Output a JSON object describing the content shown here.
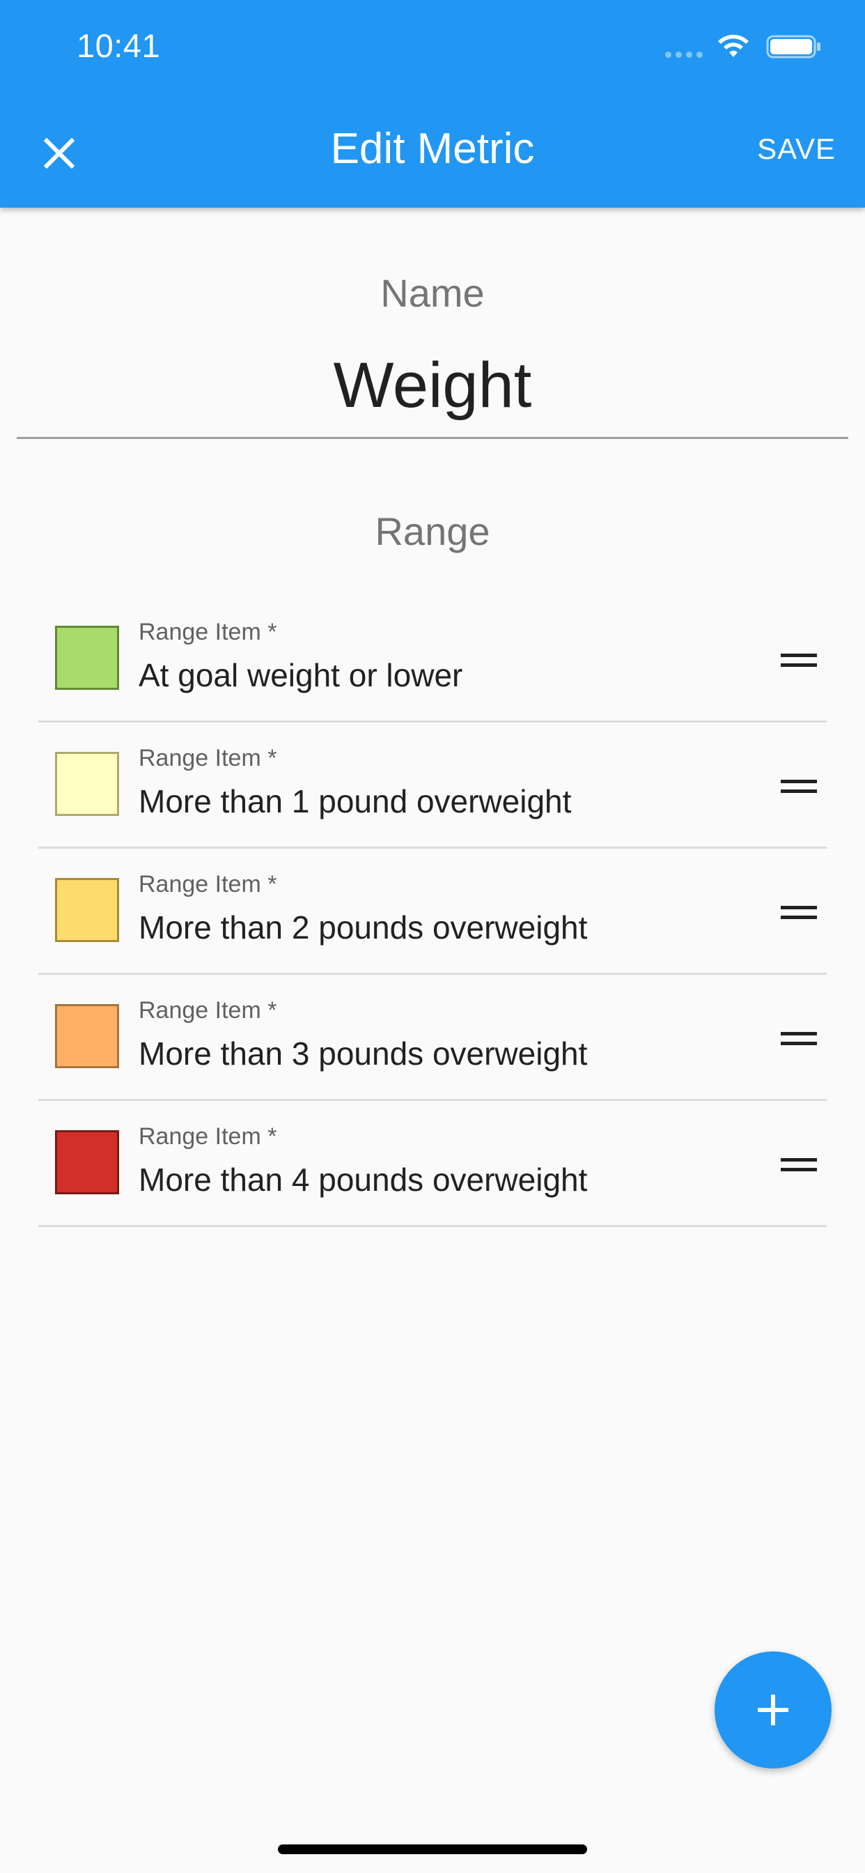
{
  "status_bar": {
    "time": "10:41"
  },
  "app_bar": {
    "title": "Edit Metric",
    "save_label": "SAVE",
    "close_icon": "close-icon"
  },
  "name_field": {
    "label": "Name",
    "value": "Weight"
  },
  "range_section": {
    "label": "Range",
    "items": [
      {
        "label": "Range Item *",
        "value": "At goal weight or lower",
        "color": "#a8db6b",
        "border": "#5f8a33"
      },
      {
        "label": "Range Item *",
        "value": "More than 1 pound overweight",
        "color": "#ffffc4",
        "border": "#b0a86a"
      },
      {
        "label": "Range Item *",
        "value": "More than 2 pounds overweight",
        "color": "#ffdb6b",
        "border": "#a88a3a"
      },
      {
        "label": "Range Item *",
        "value": "More than 3 pounds overweight",
        "color": "#ffb066",
        "border": "#a8743a"
      },
      {
        "label": "Range Item *",
        "value": "More than 4 pounds overweight",
        "color": "#d32f2a",
        "border": "#7a1a16"
      }
    ]
  },
  "fab": {
    "icon": "plus-icon"
  },
  "colors": {
    "primary": "#2196f3",
    "background": "#fafafa"
  }
}
